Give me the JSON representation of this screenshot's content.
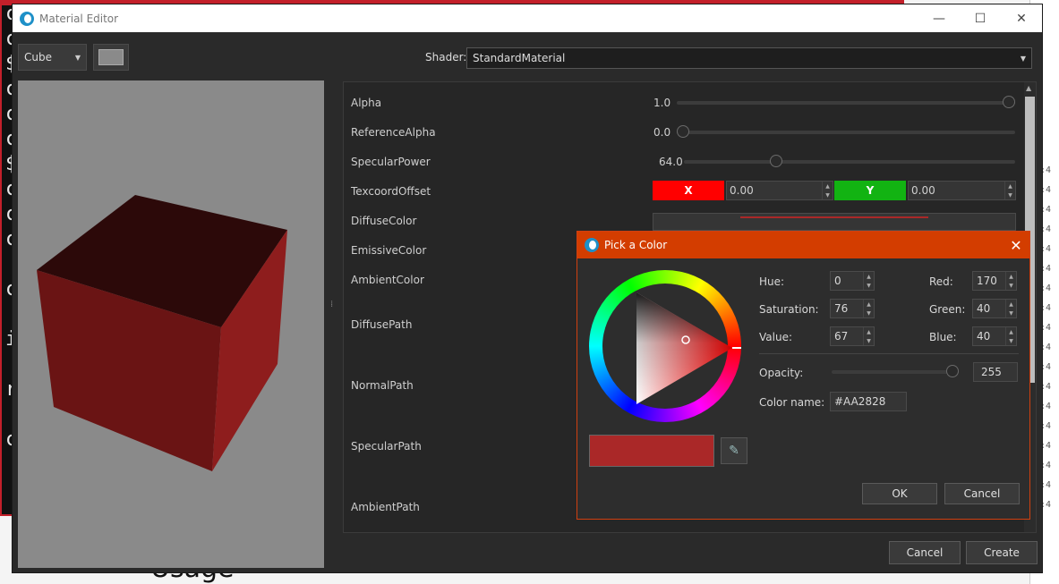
{
  "background": {
    "terminal_lines": [
      "c",
      "c",
      "$",
      "c",
      "c",
      "c",
      "$",
      "c",
      "c",
      "c",
      "",
      "c",
      "",
      "i",
      "",
      "r",
      "",
      "c"
    ],
    "usage_text": "Usage"
  },
  "window": {
    "title": "Material Editor",
    "controls": {
      "minimize": "—",
      "maximize": "☐",
      "close": "✕"
    }
  },
  "toolbar": {
    "mesh_combo": "Cube",
    "preview_bg_color": "#8a8a8a"
  },
  "shader": {
    "label": "Shader:",
    "value": "StandardMaterial"
  },
  "properties": {
    "alpha": {
      "label": "Alpha",
      "value": "1.0",
      "fraction": 1.0
    },
    "reference_alpha": {
      "label": "ReferenceAlpha",
      "value": "0.0",
      "fraction": 0.0
    },
    "specular_power": {
      "label": "SpecularPower",
      "value": "64.0",
      "fraction": 0.27
    },
    "texcoord_offset": {
      "label": "TexcoordOffset",
      "x_tag": "X",
      "x_value": "0.00",
      "y_tag": "Y",
      "y_value": "0.00"
    },
    "diffuse_color": {
      "label": "DiffuseColor"
    },
    "emissive_color": {
      "label": "EmissiveColor"
    },
    "ambient_color": {
      "label": "AmbientColor"
    },
    "diffuse_path": {
      "label": "DiffusePath"
    },
    "normal_path": {
      "label": "NormalPath"
    },
    "specular_path": {
      "label": "SpecularPath"
    },
    "ambient_path": {
      "label": "AmbientPath"
    }
  },
  "footer": {
    "cancel": "Cancel",
    "create": "Create"
  },
  "color_dialog": {
    "title": "Pick a Color",
    "close": "✕",
    "hue": {
      "label": "Hue:",
      "value": "0"
    },
    "saturation": {
      "label": "Saturation:",
      "value": "76"
    },
    "value": {
      "label": "Value:",
      "value": "67"
    },
    "red": {
      "label": "Red:",
      "value": "170"
    },
    "green": {
      "label": "Green:",
      "value": "40"
    },
    "blue": {
      "label": "Blue:",
      "value": "40"
    },
    "opacity": {
      "label": "Opacity:",
      "value": "255",
      "fraction": 1.0
    },
    "color_name": {
      "label": "Color name:",
      "value": "#AA2828"
    },
    "current_color": "#aa2828",
    "ok": "OK",
    "cancel": "Cancel"
  },
  "colors": {
    "x_tag": "#ff0000",
    "y_tag": "#12b312",
    "dialog_accent": "#d33d00",
    "cube_front": "#6a1414",
    "cube_top": "#2c0909",
    "cube_side": "#8e1d1d"
  }
}
